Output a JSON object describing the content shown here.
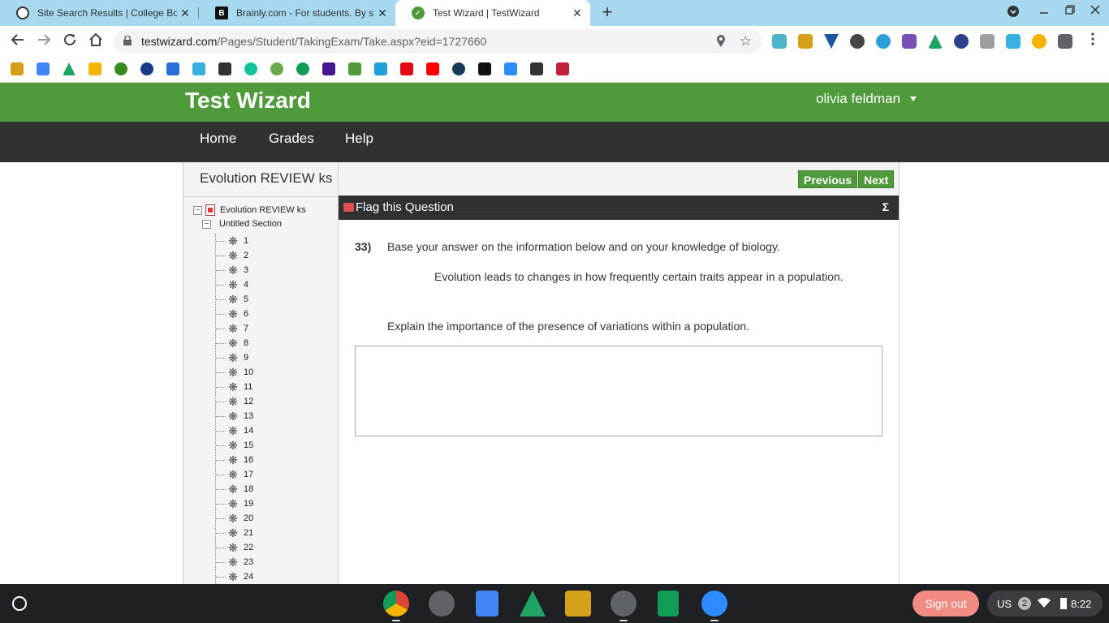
{
  "browser": {
    "tabs": [
      {
        "title": "Site Search Results | College Boa",
        "favicon": "college-board-icon",
        "active": false
      },
      {
        "title": "Brainly.com - For students. By st",
        "favicon": "brainly-icon",
        "active": false
      },
      {
        "title": "Test Wizard | TestWizard",
        "favicon": "testwizard-icon",
        "active": true
      }
    ],
    "close_glyph": "✕",
    "new_tab_glyph": "+",
    "url_host": "testwizard.com",
    "url_path": "/Pages/Student/TakingExam/Take.aspx?eid=1727660"
  },
  "site": {
    "brand": "Test Wizard",
    "user_name": "olivia feldman",
    "nav": [
      "Home",
      "Grades",
      "Help"
    ]
  },
  "sidebar": {
    "exam_title": "Evolution REVIEW ks",
    "tree_root": "Evolution REVIEW ks",
    "section": "Untitled Section",
    "questions": [
      "1",
      "2",
      "3",
      "4",
      "5",
      "6",
      "7",
      "8",
      "9",
      "10",
      "11",
      "12",
      "13",
      "14",
      "15",
      "16",
      "17",
      "18",
      "19",
      "20",
      "21",
      "22",
      "23",
      "24"
    ]
  },
  "question": {
    "prev_label": "Previous",
    "next_label": "Next",
    "flag_label": "Flag this Question",
    "sigma": "Σ",
    "number": "33)",
    "text": "Base your answer on the information below and on your knowledge of biology.",
    "passage": "Evolution leads to changes in how frequently certain traits appear in a population.",
    "prompt": "Explain the importance of the presence of variations within a population.",
    "answer_value": ""
  },
  "shelf": {
    "sign_out": "Sign out",
    "ime": "US",
    "notification_count": "2",
    "time": "8:22"
  },
  "colors": {
    "brand_green": "#4f9a3a",
    "dark_bar": "#2f3132",
    "tabstrip": "#a6d8f0"
  }
}
